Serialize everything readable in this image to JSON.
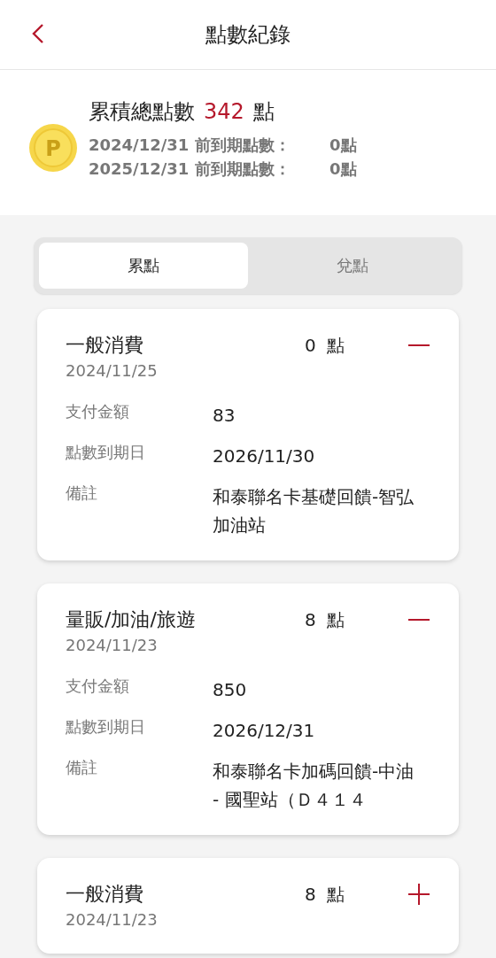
{
  "header": {
    "title": "點數紀錄"
  },
  "summary": {
    "coin_label": "P",
    "label": "累積總點數",
    "total": "342",
    "unit": "點",
    "expiring": [
      {
        "label": "2024/12/31 前到期點數：",
        "value": "0點"
      },
      {
        "label": "2025/12/31 前到期點數：",
        "value": "0點"
      }
    ]
  },
  "tabs": [
    {
      "label": "累點",
      "selected": true
    },
    {
      "label": "兌點",
      "selected": false
    }
  ],
  "records": [
    {
      "title": "一般消費",
      "date": "2024/11/25",
      "points": "0",
      "unit": "點",
      "expanded": true,
      "details": [
        {
          "label": "支付金額",
          "value": "83"
        },
        {
          "label": "點數到期日",
          "value": "2026/11/30"
        },
        {
          "label": "備註",
          "value": "和泰聯名卡基礎回饋-智弘加油站"
        }
      ]
    },
    {
      "title": "量販/加油/旅遊",
      "date": "2024/11/23",
      "points": "8",
      "unit": "點",
      "expanded": true,
      "details": [
        {
          "label": "支付金額",
          "value": "850"
        },
        {
          "label": "點數到期日",
          "value": "2026/12/31"
        },
        {
          "label": "備註",
          "value": "和泰聯名卡加碼回饋-中油 - 國聖站（Ｄ４１４"
        }
      ]
    },
    {
      "title": "一般消費",
      "date": "2024/11/23",
      "points": "8",
      "unit": "點",
      "expanded": false
    }
  ]
}
